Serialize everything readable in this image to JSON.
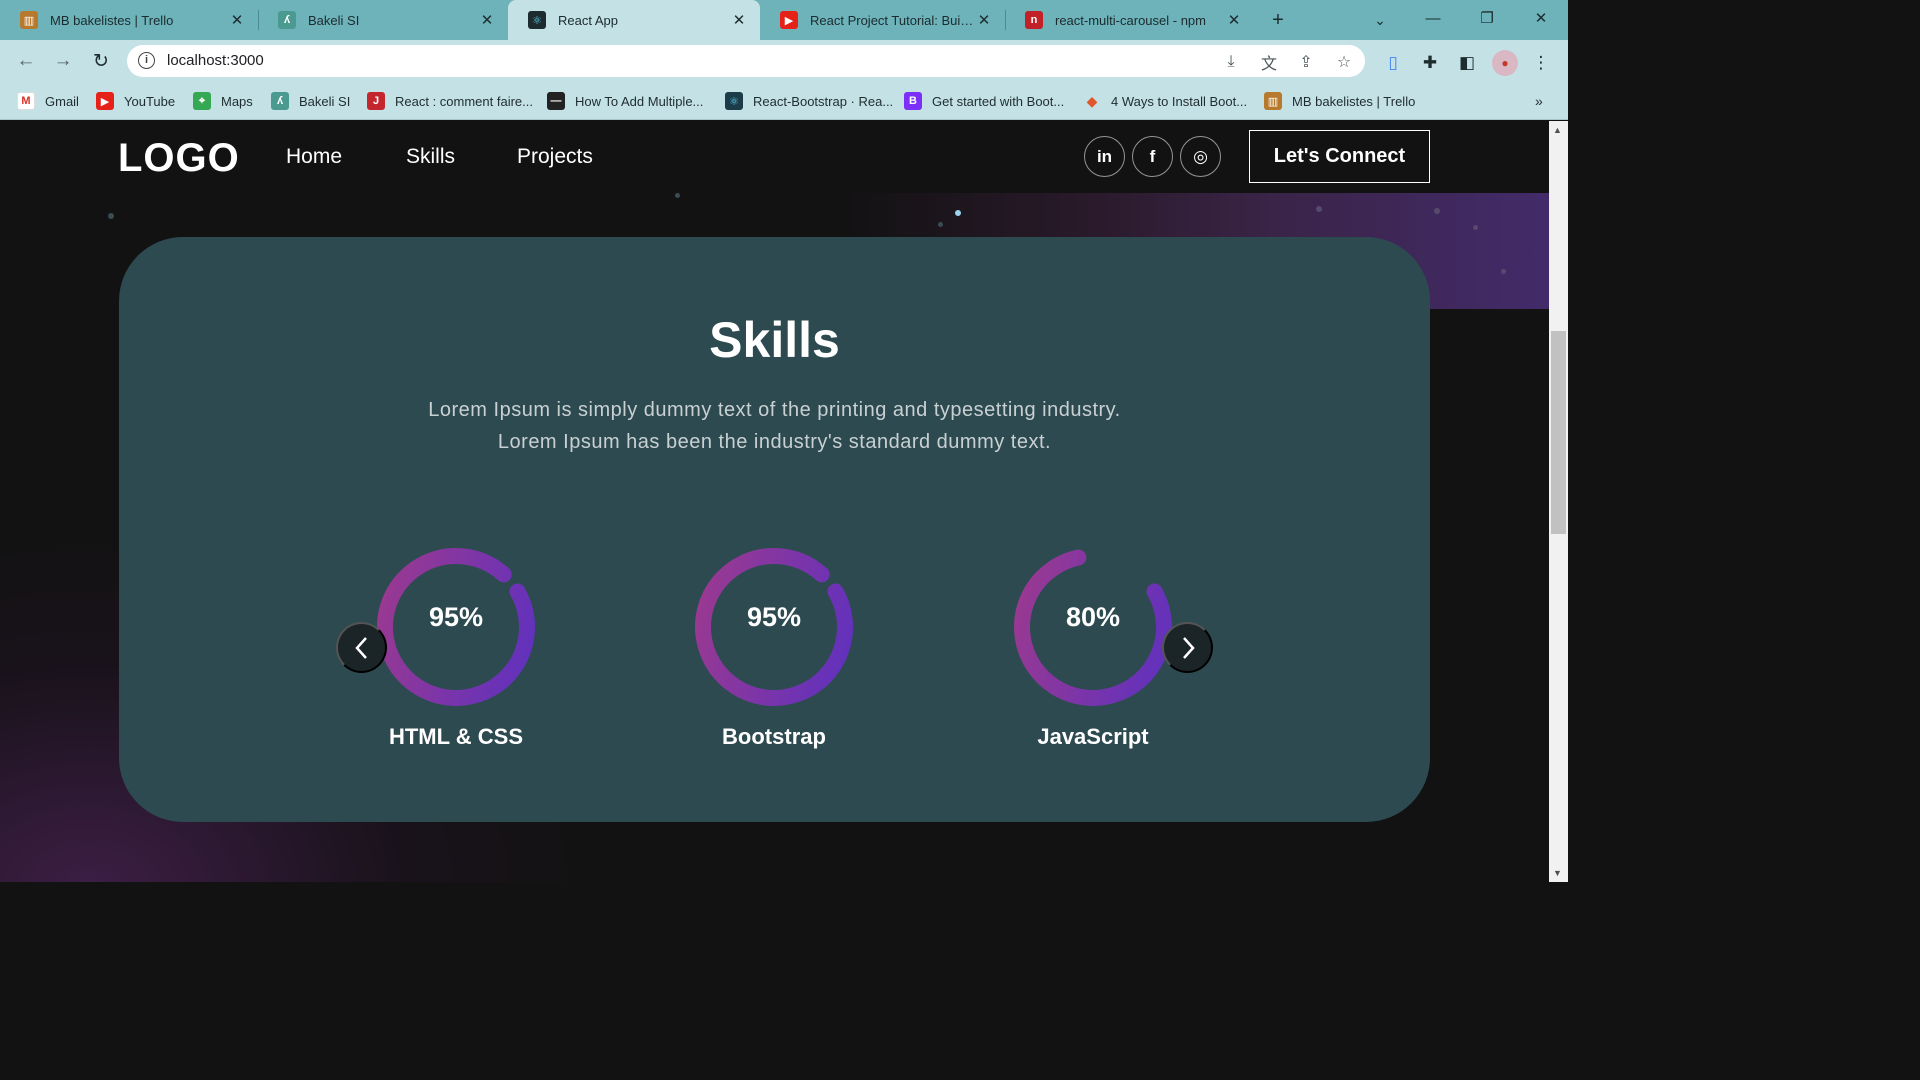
{
  "browser": {
    "tabs": [
      {
        "title": "MB bakelistes | Trello",
        "icon": "trello-icon",
        "color": "#b7792b",
        "active": false
      },
      {
        "title": "Bakeli SI",
        "icon": "bakeli-icon",
        "color": "#4b9a8f",
        "active": false
      },
      {
        "title": "React App",
        "icon": "react-icon",
        "color": "#1d2b2f",
        "active": true
      },
      {
        "title": "React Project Tutorial: Build a R",
        "icon": "youtube-icon",
        "color": "#e62117",
        "active": false
      },
      {
        "title": "react-multi-carousel - npm",
        "icon": "npm-icon",
        "color": "#c12127",
        "active": false
      }
    ],
    "url": "localhost:3000",
    "bookmarks": [
      {
        "label": "Gmail",
        "icon": "gmail-icon",
        "color": "#d93025"
      },
      {
        "label": "YouTube",
        "icon": "youtube-icon",
        "color": "#e62117"
      },
      {
        "label": "Maps",
        "icon": "maps-icon",
        "color": "#34a853"
      },
      {
        "label": "Bakeli SI",
        "icon": "bakeli-icon",
        "color": "#4b9a8f"
      },
      {
        "label": "React : comment faire...",
        "icon": "j-icon",
        "color": "#c4262e"
      },
      {
        "label": "How To Add Multiple...",
        "icon": "dev-icon",
        "color": "#222222"
      },
      {
        "label": "React-Bootstrap · Rea...",
        "icon": "react-bootstrap-icon",
        "color": "#1d3c4a"
      },
      {
        "label": "Get started with Boot...",
        "icon": "bootstrap-icon",
        "color": "#7b2ff7"
      },
      {
        "label": "4 Ways to Install Boot...",
        "icon": "git-icon",
        "color": "#e0572e"
      },
      {
        "label": "MB bakelistes | Trello",
        "icon": "trello-icon",
        "color": "#b7792b"
      }
    ]
  },
  "page": {
    "logo": "LOGO",
    "nav": {
      "home": "Home",
      "skills": "Skills",
      "projects": "Projects"
    },
    "social": [
      {
        "icon": "linkedin-icon",
        "glyph": "in"
      },
      {
        "icon": "facebook-icon",
        "glyph": "f"
      },
      {
        "icon": "instagram-icon",
        "glyph": "◎"
      }
    ],
    "connect_label": "Let's Connect",
    "skills": {
      "title": "Skills",
      "description_line1": "Lorem Ipsum is simply dummy text of the printing and typesetting industry.",
      "description_line2": "Lorem Ipsum has been the industry's standard dummy text.",
      "items": [
        {
          "percent_label": "95%",
          "value": 0.95,
          "name": "HTML & CSS"
        },
        {
          "percent_label": "95%",
          "value": 0.95,
          "name": "Bootstrap"
        },
        {
          "percent_label": "80%",
          "value": 0.8,
          "name": "JavaScript"
        }
      ]
    },
    "colors": {
      "ring_start": "#a03a8c",
      "ring_end": "#5b30c2",
      "card": "#2d4a51"
    }
  }
}
